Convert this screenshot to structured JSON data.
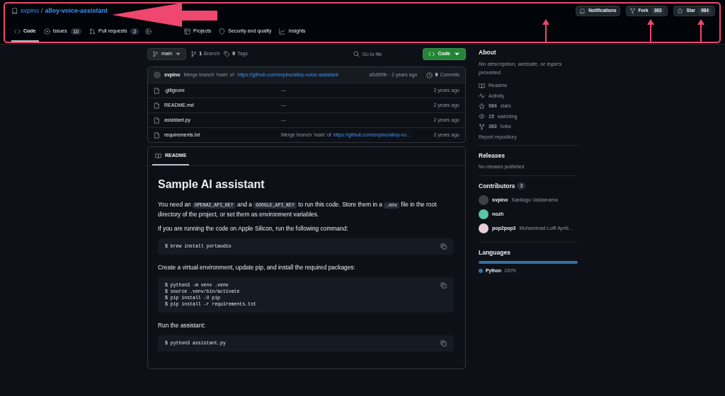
{
  "header": {
    "owner": "svpino",
    "separator": "/",
    "repo": "alloy-voice-assistant",
    "actions": [
      {
        "kind": "notifications",
        "label": "Notifications"
      },
      {
        "kind": "fork",
        "label": "Fork",
        "count": "363"
      },
      {
        "kind": "star",
        "label": "Star",
        "count": "984"
      }
    ]
  },
  "tabs": [
    {
      "kind": "code",
      "label": "Code",
      "selected": true
    },
    {
      "kind": "issues",
      "label": "Issues",
      "count": "10",
      "selected": false
    },
    {
      "kind": "pulls",
      "label": "Pull requests",
      "count": "2",
      "selected": false
    },
    {
      "kind": "actions",
      "selected": false
    },
    {
      "kind": "projects",
      "label": "Projects",
      "selected": false
    },
    {
      "kind": "security",
      "label": "Security and quality",
      "selected": false
    },
    {
      "kind": "insights",
      "label": "Insights",
      "selected": false
    }
  ],
  "toolbar": {
    "branch": "main",
    "branches": {
      "count": "1",
      "label": "Branch"
    },
    "tags": {
      "count": "0",
      "label": "Tags"
    },
    "search": {
      "placeholder": "Go to file"
    },
    "code_button": "Code"
  },
  "latest_commit": {
    "author": "svpino",
    "message": "Merge branch 'main' of",
    "link": "https://github.com/svpino/alloy-voice-assistant",
    "hash_time": "a5d9f9b · 2 years ago",
    "commits": {
      "count": "9",
      "label": "Commits"
    }
  },
  "files": [
    {
      "name": ".gitignore",
      "message": "—",
      "time": "2 years ago"
    },
    {
      "name": "README.md",
      "message": "—",
      "time": "2 years ago"
    },
    {
      "name": "assistant.py",
      "message": "—",
      "time": "2 years ago"
    },
    {
      "name": "requirements.txt",
      "message": "Merge branch 'main' of",
      "link": "https://github.com/svpino/alloy-vo…",
      "time": "2 years ago"
    }
  ],
  "readme": {
    "tab": "README",
    "heading": "Sample AI assistant",
    "blocks": [
      {
        "kind": "paragraph",
        "segments": [
          {
            "kind": "text",
            "text": "You need an "
          },
          {
            "kind": "code",
            "text": "OPENAI_API_KEY"
          },
          {
            "kind": "text",
            "text": " and a "
          },
          {
            "kind": "code",
            "text": "GOOGLE_API_KEY"
          },
          {
            "kind": "text",
            "text": " to run this code. Store them in a "
          },
          {
            "kind": "code",
            "text": ".env"
          },
          {
            "kind": "text",
            "text": " file in the root directory of the project, or set them as environment variables."
          }
        ]
      },
      {
        "kind": "paragraph",
        "segments": [
          {
            "kind": "text",
            "text": "If you are running the code on Apple Silicon, run the following command:"
          }
        ]
      },
      {
        "kind": "code",
        "lines": [
          "$ brew install portaudio"
        ]
      },
      {
        "kind": "paragraph",
        "segments": [
          {
            "kind": "text",
            "text": "Create a virtual environment, update pip, and install the required packages:"
          }
        ]
      },
      {
        "kind": "code",
        "lines": [
          "$ python3 -m venv .venv",
          "$ source .venv/bin/activate",
          "$ pip install -U pip",
          "$ pip install -r requirements.txt"
        ]
      },
      {
        "kind": "paragraph",
        "segments": [
          {
            "kind": "text",
            "text": "Run the assistant:"
          }
        ]
      },
      {
        "kind": "code",
        "lines": [
          "$ python3 assistant.py"
        ]
      }
    ]
  },
  "sidebar": {
    "about": {
      "title": "About",
      "description": "No description, website, or topics provided.",
      "links": [
        {
          "kind": "readme",
          "label": "Readme"
        },
        {
          "kind": "activity",
          "label": "Activity"
        },
        {
          "kind": "stars",
          "count": "984",
          "label": "stars"
        },
        {
          "kind": "watching",
          "count": "15",
          "label": "watching"
        },
        {
          "kind": "forks",
          "count": "363",
          "label": "forks"
        }
      ],
      "report": "Report repository"
    },
    "releases": {
      "title": "Releases",
      "note": "No releases published"
    },
    "contributors": {
      "title": "Contributors",
      "count": "3",
      "people": [
        {
          "login": "svpino",
          "name": "Santiago Valdarrama",
          "color": "#3d4247"
        },
        {
          "login": "nozh",
          "color": "#5cc4a9"
        },
        {
          "login": "pop2pop3",
          "name": "Muhammad Lutfi Aprili…",
          "color": "#e9cdd6"
        }
      ]
    },
    "languages": {
      "title": "Languages",
      "items": [
        {
          "name": "Python",
          "share": "100%",
          "color": "#3572a5",
          "level": 1
        }
      ]
    }
  }
}
